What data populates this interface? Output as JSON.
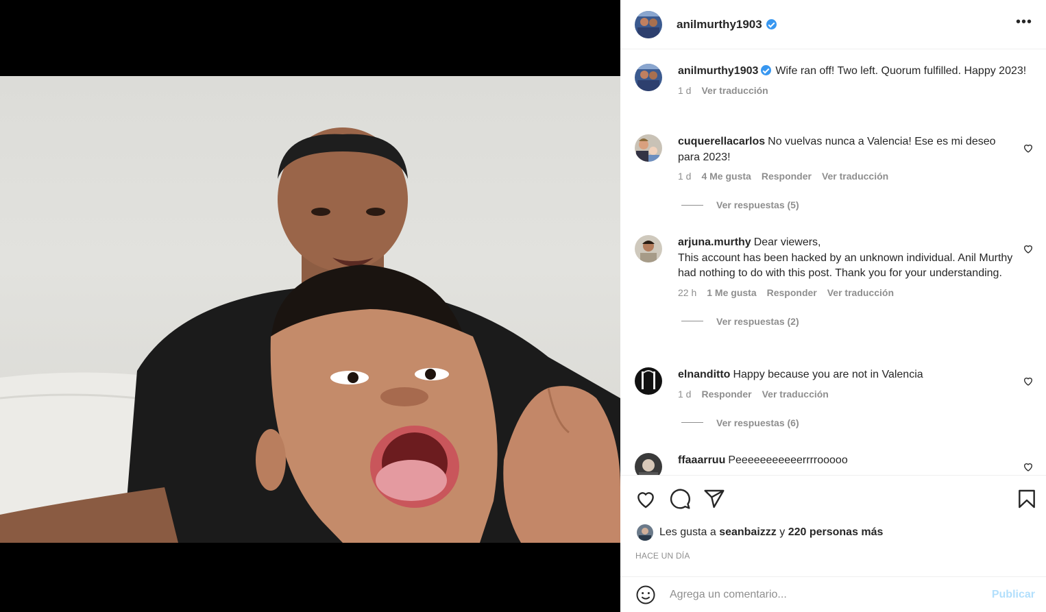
{
  "post": {
    "author": "anilmurthy1903",
    "caption_user": "anilmurthy1903",
    "caption": "Wife ran off! Two left. Quorum fulfilled. Happy 2023!",
    "caption_time": "1 d",
    "caption_translate": "Ver traducción"
  },
  "comments": [
    {
      "user": "cuquerellacarlos",
      "text": "No vuelvas nunca a Valencia! Ese es mi deseo para 2023!",
      "time": "1 d",
      "likes": "4 Me gusta",
      "reply": "Responder",
      "translate": "Ver traducción",
      "replies": "Ver respuestas (5)"
    },
    {
      "user": "arjuna.murthy",
      "text": "Dear viewers,",
      "text2": "This account has been hacked by an unknown individual. Anil Murthy had nothing to do with this post. Thank you for your understanding.",
      "time": "22 h",
      "likes": "1 Me gusta",
      "reply": "Responder",
      "translate": "Ver traducción",
      "replies": "Ver respuestas (2)"
    },
    {
      "user": "elnanditto",
      "text": "Happy because you are not in Valencia",
      "time": "1 d",
      "reply": "Responder",
      "translate": "Ver traducción",
      "replies": "Ver respuestas (6)"
    },
    {
      "user": "ffaaarruu",
      "text": "Peeeeeeeeeeerrrrooooo"
    }
  ],
  "likes_line": {
    "prefix": "Les gusta a",
    "user": "seanbaizzz",
    "conj": "y",
    "others": "220 personas más"
  },
  "time_ago": "HACE UN DÍA",
  "comment_box": {
    "placeholder": "Agrega un comentario...",
    "publish": "Publicar"
  },
  "icons": {
    "more": "more-options-icon",
    "verified": "verified-badge-icon",
    "like": "heart-icon",
    "comment": "comment-bubble-icon",
    "share": "paper-plane-icon",
    "save": "bookmark-icon",
    "emoji": "emoji-icon"
  },
  "colors": {
    "verified": "#3897f0",
    "publish_disabled": "#b2dffc",
    "secondary_text": "#8e8e8e"
  }
}
